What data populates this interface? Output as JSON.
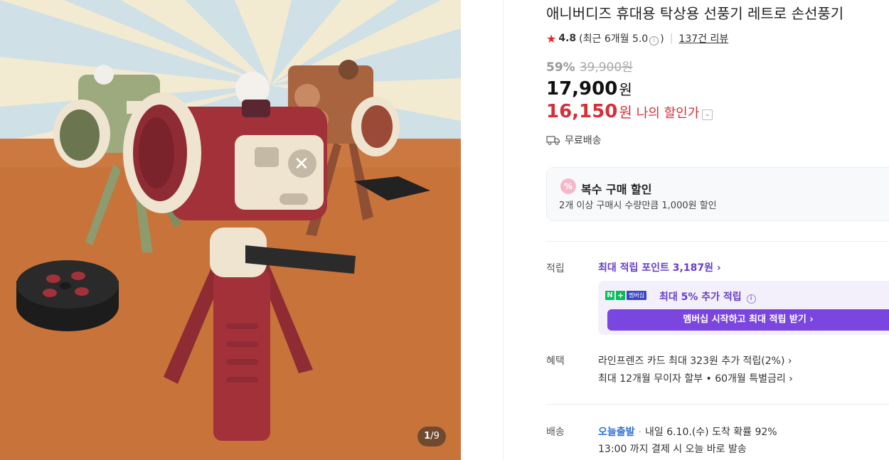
{
  "image": {
    "alt_colors": {
      "sky": "#cfe0e6",
      "ray": "#f3ead2",
      "floor": "#c8733a",
      "red": "#a3313a",
      "cream": "#efe4cf",
      "green": "#9caa7e",
      "brown": "#a8643f"
    },
    "counter_current": "1",
    "counter_total": "/9"
  },
  "product": {
    "title": "애니버디즈 휴대용 탁상용 선풍기 레트로 손선풍기",
    "rating": "4.8",
    "rating_detail_prefix": "(최근 6개월 5.0",
    "rating_detail_suffix": ")",
    "review_link": "137건 리뷰",
    "discount_percent": "59%",
    "original_price": "39,900원",
    "price": "17,900",
    "price_unit": "원",
    "my_price": "16,150",
    "my_price_unit": "원",
    "my_price_label": "나의 할인가",
    "shipping": "무료배송"
  },
  "bulk": {
    "icon": "%",
    "title": "복수 구매 할인",
    "desc": "2개 이상 구매시 수량만큼 1,000원 할인"
  },
  "points": {
    "label": "적립",
    "link": "최대 적립 포인트 3,187원 ›",
    "badge_n": "N",
    "badge_plus": "+",
    "badge_member": "멤버십",
    "member_text": "최대 5% 추가 적립",
    "member_button": "멤버십 시작하고 최대 적립 받기 ›"
  },
  "benefits": {
    "label": "혜택",
    "line1": "라인프렌즈 카드 최대 323원 추가 적립(2%) ›",
    "line2": "최대 12개월 무이자 할부 • 60개월 특별금리 ›"
  },
  "delivery": {
    "label": "배송",
    "badge": "오늘출발",
    "line1_rest": "내일 6.10.(수) 도착 확률 92%",
    "line2": "13:00 까지 결제 시 오늘 바로 발송"
  }
}
